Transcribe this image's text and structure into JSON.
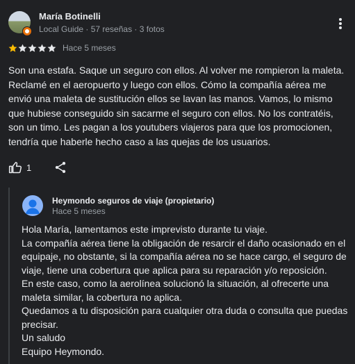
{
  "review": {
    "author": {
      "name": "María Botinelli",
      "meta": "Local Guide · 57 reseñas · 3 fotos"
    },
    "rating": {
      "value": 1,
      "max": 5
    },
    "time": "Hace 5 meses",
    "text": "Son una estafa. Saque un seguro con ellos. Al volver me rompieron la maleta. Reclamé en el aeropuerto y luego con ellos. Cómo la compañía aérea me envió una maleta de sustitución ellos se lavan las manos. Vamos, lo mismo que hubiese conseguido sin sacarme el seguro con ellos. No los contratéis, son un timo. Les pagan a los youtubers viajeros para que los promocionen, tendría que haberle hecho caso a las quejas de los usuarios.",
    "likes": "1",
    "icons": {
      "like": "thumb-up-icon",
      "share": "share-icon",
      "more": "more-vert-icon"
    }
  },
  "owner_reply": {
    "name": "Heymondo seguros de viaje (propietario)",
    "time": "Hace 5 meses",
    "lines": [
      "Hola María, lamentamos este imprevisto durante tu viaje.",
      "La compañía aérea tiene la obligación de resarcir el daño ocasionado en el equipaje, no obstante, si la compañía aérea no se hace cargo, el seguro de viaje, tiene una cobertura que aplica para su reparación y/o reposición.",
      "En este caso, como la aerolínea solucionó la situación, al ofrecerte una maleta similar, la cobertura no aplica.",
      "Quedamos a tu disposición para cualquier otra duda o consulta que puedas precisar.",
      "Un saludo",
      "Equipo Heymondo."
    ]
  },
  "colors": {
    "background": "#202124",
    "text": "#e8eaed",
    "secondary_text": "#9aa0a6",
    "star_filled": "#fbbc04",
    "star_empty": "#e8eaed"
  }
}
